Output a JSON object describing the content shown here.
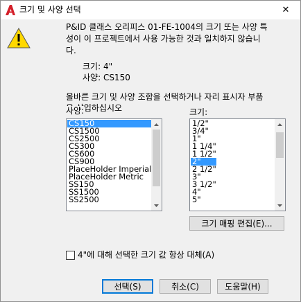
{
  "window": {
    "title": "크기 및 사양 선택",
    "close_glyph": "✕"
  },
  "message": {
    "text": "P&ID 클래스 오리피스 01-FE-1004의 크기 또는 사양 특\n성이 이 프로젝트에서 사용 가능한 것과 일치하지 않습니\n다.",
    "size_line": "크기: 4\"",
    "spec_line": "사양: CS150",
    "prompt": "올바른 크기 및 사양 조합을 선택하거나 자리 표시자 부품\n을 삽입하십시오"
  },
  "spec_list": {
    "label": "사양:",
    "items": [
      "CS150",
      "CS1500",
      "CS2500",
      "CS300",
      "CS600",
      "CS900",
      "PlaceHolder Imperial",
      "PlaceHolder Metric",
      "SS150",
      "SS1500",
      "SS2500"
    ],
    "selected_index": 0
  },
  "size_list": {
    "label": "크기:",
    "items": [
      "1/2\"",
      "3/4\"",
      "1\"",
      "1 1/4\"",
      "1 1/2\"",
      "2\"",
      "2 1/2\"",
      "3\"",
      "3 1/2\"",
      "4\"",
      "5\""
    ],
    "selected_index": 5
  },
  "buttons": {
    "edit_size_mapping": "크기 매핑 편집(E)...",
    "select": "선택(S)",
    "cancel": "취소(C)",
    "help": "도움말(H)"
  },
  "checkbox": {
    "label": "4\"에 대해 선택한 크기 값 항상 대체(A)",
    "checked": false
  },
  "colors": {
    "selection": "#3399ff",
    "dialog_bg": "#f0f0f0",
    "warning_yellow": "#ffd800",
    "autocad_red": "#d4202a"
  },
  "icons": {
    "app": "autocad-a-icon",
    "warning": "warning-triangle-icon"
  }
}
